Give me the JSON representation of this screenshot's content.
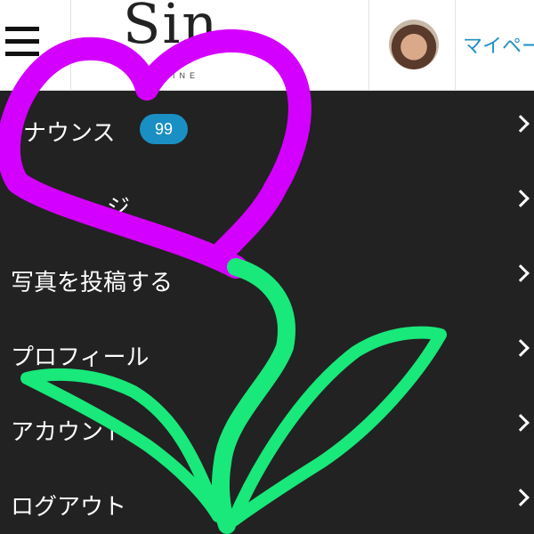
{
  "header": {
    "menu_icon": "hamburger-icon",
    "logo_text": "Sin",
    "logo_subtext": "INE",
    "avatar_icon": "user-avatar",
    "mypage_label": "マイペー"
  },
  "menu": {
    "items": [
      {
        "label": "ナウンス",
        "badge": "99"
      },
      {
        "label": "ジ"
      },
      {
        "label": "写真を投稿する"
      },
      {
        "label": "プロフィール"
      },
      {
        "label": "アカウント"
      },
      {
        "label": "ログアウト"
      }
    ]
  },
  "overlay": {
    "heart_color": "#d400ff",
    "stem_color": "#19e87a"
  },
  "colors": {
    "menu_bg": "#222222",
    "accent": "#1a8fc4",
    "link": "#1f8fc4"
  }
}
